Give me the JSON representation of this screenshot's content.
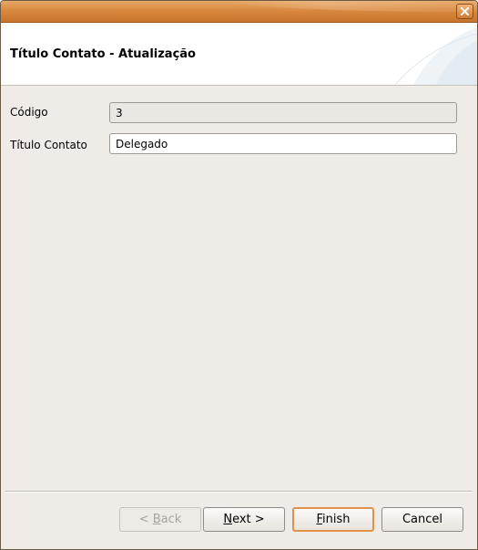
{
  "window": {
    "close_icon": "close-icon"
  },
  "header": {
    "title": "Título Contato - Atualização"
  },
  "form": {
    "codigo": {
      "label": "Código",
      "value": "3"
    },
    "titulo": {
      "label": "Título Contato",
      "value": "Delegado"
    }
  },
  "buttons": {
    "back": {
      "prefix": "< ",
      "mnemonic": "B",
      "rest": "ack",
      "enabled": false
    },
    "next": {
      "prefix": "",
      "mnemonic": "N",
      "rest": "ext >",
      "enabled": true
    },
    "finish": {
      "prefix": "",
      "mnemonic": "F",
      "rest": "inish",
      "enabled": true,
      "default": true
    },
    "cancel": {
      "label": "Cancel",
      "enabled": true
    }
  },
  "colors": {
    "titlebar": "#d9893f",
    "background": "#efebe7",
    "default_button_border": "#e0914a"
  }
}
